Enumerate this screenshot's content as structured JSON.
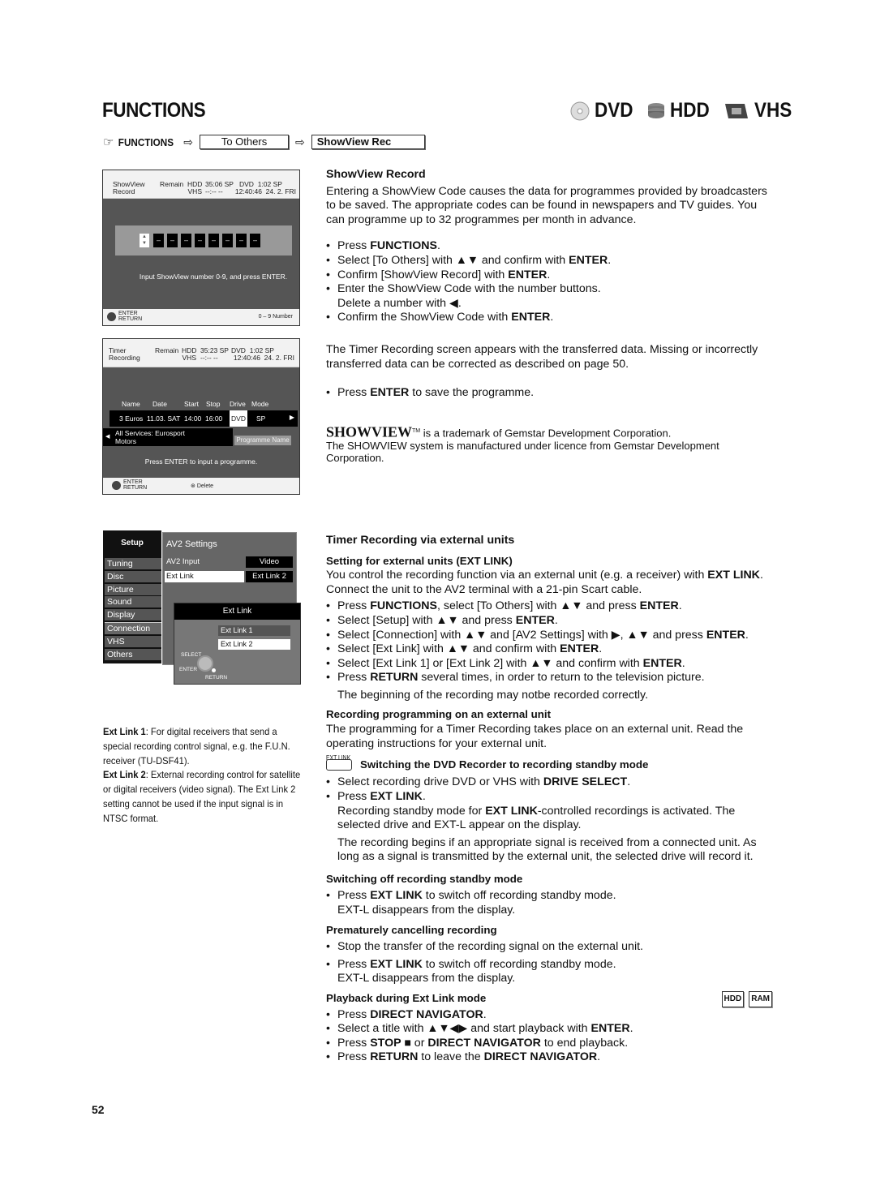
{
  "page": {
    "title": "FUNCTIONS",
    "page_number": "52",
    "formats": [
      {
        "icon": "dvd-disc-icon",
        "label": "DVD"
      },
      {
        "icon": "hdd-stack-icon",
        "label": "HDD"
      },
      {
        "icon": "vhs-tape-icon",
        "label": "VHS"
      }
    ]
  },
  "breadcrumb": {
    "start": "FUNCTIONS",
    "step1": "To Others",
    "step2": "ShowView Rec"
  },
  "osd_showview": {
    "title_l1": "ShowView",
    "title_l2": "Record",
    "remain": "Remain",
    "hdd_label": "HDD",
    "hdd_value": "35:06 SP",
    "vhs_label": "VHS",
    "vhs_value": "--:--  --",
    "dvd_label": "DVD",
    "dvd_value": "1:02 SP",
    "clock": "12:40:46",
    "date": "24. 2. FRI",
    "digits": [
      "–",
      "–",
      "–",
      "–",
      "–",
      "–",
      "–",
      "–"
    ],
    "prompt": "Input ShowView number 0-9, and press ENTER.",
    "footer_enter": "ENTER",
    "footer_return": "RETURN",
    "footer_right": "0 – 9  Number"
  },
  "osd_timer": {
    "title_l1": "Timer",
    "title_l2": "Recording",
    "remain": "Remain",
    "hdd_label": "HDD",
    "hdd_value": "35:23 SP",
    "vhs_label": "VHS",
    "vhs_value": "--:--  --",
    "dvd_label": "DVD",
    "dvd_value": "1:02 SP",
    "clock": "12:40:46",
    "date": "24. 2. FRI",
    "columns": [
      "Name",
      "Date",
      "Start",
      "Stop",
      "Drive",
      "Mode"
    ],
    "row": {
      "name": "3 Euros",
      "date": "11.03. SAT",
      "start": "14:00",
      "stop": "16:00",
      "drive": "DVD",
      "mode": "SP"
    },
    "service_l1": "All Services: Eurosport",
    "service_l2": "Motors",
    "programme_name_btn": "Programme Name",
    "prompt": "Press ENTER to input a programme.",
    "footer_enter": "ENTER",
    "footer_return": "RETURN",
    "footer_delete": "Delete"
  },
  "osd_setup": {
    "menu_title": "Setup",
    "menu_items": [
      "Tuning",
      "Disc",
      "Picture",
      "Sound",
      "Display",
      "Connection",
      "VHS",
      "Others"
    ],
    "selected_item": "Connection",
    "panel_title": "AV2 Settings",
    "rows": [
      {
        "label": "AV2 Input",
        "value": "Video"
      },
      {
        "label": "Ext Link",
        "value": "Ext Link 2"
      }
    ],
    "popup_title": "Ext Link",
    "popup_options": [
      "Ext Link 1",
      "Ext Link 2"
    ],
    "popup_selected": "Ext Link 2",
    "nav_select": "SELECT",
    "nav_enter": "ENTER",
    "nav_return": "RETURN"
  },
  "note": {
    "l1_bold": "Ext Link 1",
    "l1_text": ": For digital receivers that send a special recording control signal, e.g. the F.U.N. receiver (TU-DSF41).",
    "l2_bold": "Ext Link 2",
    "l2_text": ": External recording control for satellite or digital receivers (video signal). The Ext Link 2 setting cannot be used if the input signal is in NTSC format."
  },
  "showview": {
    "heading": "ShowView Record",
    "intro": "Entering a ShowView Code causes the data for programmes provided by broadcasters to be saved. The appropriate codes can be found in newspapers and TV guides. You can programme up to 32 programmes per month in advance.",
    "steps": [
      [
        "Press ",
        "FUNCTIONS",
        "."
      ],
      [
        "Select [To Others] with ▲▼ and confirm with ",
        "ENTER",
        "."
      ],
      [
        "Confirm [ShowView Record] with ",
        "ENTER",
        "."
      ],
      [
        "Enter the ShowView Code with the number buttons. Delete a number with ◀.",
        "",
        ""
      ],
      [
        "Confirm the ShowView Code with ",
        "ENTER",
        "."
      ]
    ],
    "after": "The Timer Recording screen appears with the transferred data. Missing or incorrectly transferred data can be corrected as described on page 50.",
    "save_step": [
      "Press ",
      "ENTER",
      " to save the programme."
    ],
    "tm_logo": "SHOWVIEW",
    "tm_sup": "TM",
    "tm_line1": " is a trademark of Gemstar Development Corporation.",
    "tm_line2": "The SHOWVIEW system is manufactured under licence from Gemstar Development Corporation."
  },
  "timer_ext": {
    "heading": "Timer Recording via external units",
    "sub1": "Setting for external units (EXT LINK)",
    "sub1_text_a": "You control the recording function via an external unit (e.g. a receiver) with ",
    "sub1_text_bold": "EXT LINK",
    "sub1_text_b": ". Connect the unit to the AV2 terminal with a 21-pin Scart cable.",
    "steps": [
      [
        "Press ",
        "FUNCTIONS",
        ", select [To Others] with ▲▼ and press ",
        "ENTER",
        "."
      ],
      [
        "Select [Setup] with ▲▼ and press ",
        "ENTER",
        ".",
        "",
        ""
      ],
      [
        "Select [Connection] with ▲▼ and [AV2 Settings] with ▶, ▲▼ and press ",
        "ENTER",
        ".",
        "",
        ""
      ],
      [
        "Select [Ext Link] with ▲▼ and confirm with ",
        "ENTER",
        ".",
        "",
        ""
      ],
      [
        "Select [Ext Link 1] or [Ext Link 2] with ▲▼ and confirm with ",
        "ENTER",
        ".",
        "",
        ""
      ],
      [
        "Press ",
        "RETURN",
        " several times, in order to return to the television picture.",
        "",
        ""
      ]
    ],
    "caution": "The beginning of the recording may notbe recorded correctly.",
    "sub2": "Recording programming on an external unit",
    "sub2_text": "The programming for a Timer Recording takes place on an external unit. Read the operating instructions for your external unit.",
    "ext_link_btn_label": "EXT LINK",
    "sub3": "Switching the DVD Recorder to recording standby mode",
    "sub3_steps": [
      [
        "Select recording drive DVD or VHS with ",
        "DRIVE SELECT",
        "."
      ],
      [
        "Press ",
        "EXT LINK",
        "."
      ]
    ],
    "sub3_p1_a": "Recording standby mode for ",
    "sub3_p1_bold": "EXT LINK",
    "sub3_p1_b": "-controlled recordings is activated. The selected drive and EXT-L appear on the display.",
    "sub3_p2": "The recording begins if an appropriate signal is received from a connected unit. As long as a signal is transmitted by the external unit, the selected drive will record it.",
    "sub4": "Switching off recording standby mode",
    "sub4_step": [
      "Press ",
      "EXT LINK",
      " to switch off recording standby mode."
    ],
    "sub4_cont": "EXT-L disappears from the display.",
    "sub5": "Prematurely cancelling recording",
    "sub5_step1": "Stop the transfer of the recording signal on the external unit.",
    "sub5_step2": [
      "Press ",
      "EXT LINK",
      " to switch off recording standby mode."
    ],
    "sub5_cont": "EXT-L disappears from the display.",
    "sub6": "Playback during Ext Link mode",
    "sub6_badges": [
      "HDD",
      "RAM"
    ],
    "sub6_steps": [
      [
        "Press ",
        "DIRECT NAVIGATOR",
        ".",
        "",
        ""
      ],
      [
        "Select a title with ▲▼◀▶ and start playback with ",
        "ENTER",
        ".",
        "",
        ""
      ],
      [
        "Press ",
        "STOP ■",
        " or ",
        "DIRECT NAVIGATOR",
        " to end playback."
      ],
      [
        "Press ",
        "RETURN",
        " to leave the ",
        "DIRECT NAVIGATOR",
        "."
      ]
    ]
  }
}
